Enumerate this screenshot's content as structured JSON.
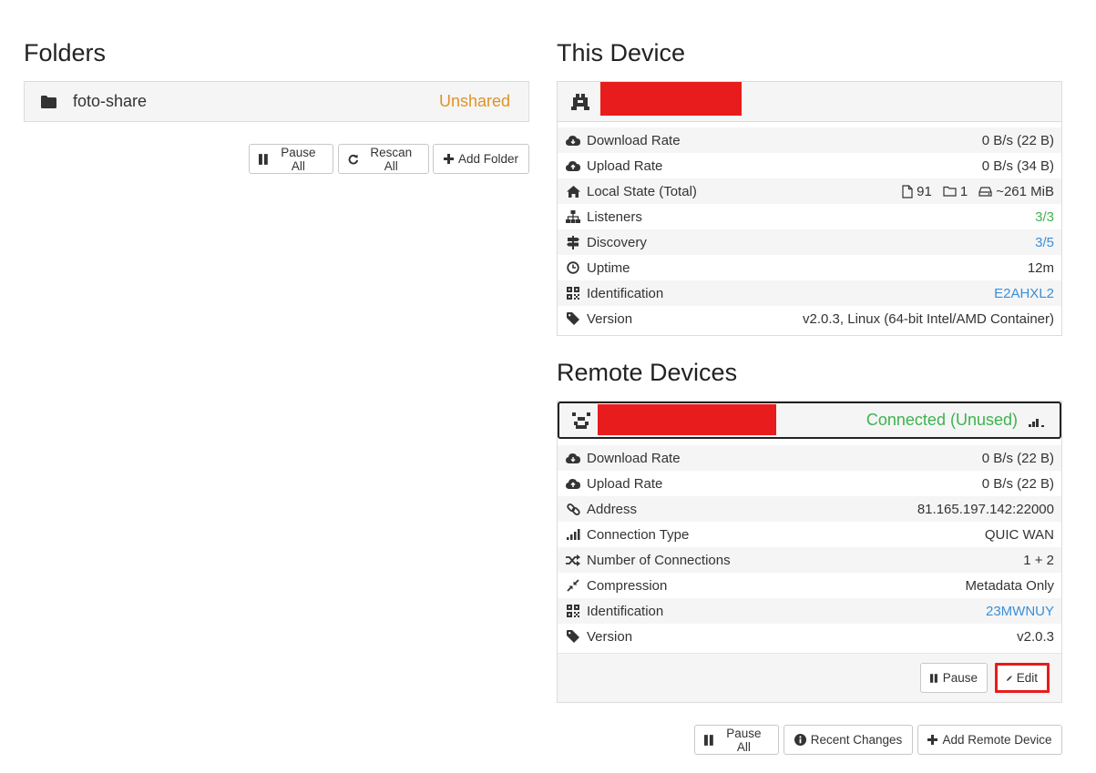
{
  "folders": {
    "heading": "Folders",
    "items": [
      {
        "name": "foto-share",
        "status": "Unshared",
        "status_color": "#e0932a"
      }
    ],
    "buttons": {
      "pause_all": "Pause All",
      "rescan_all": "Rescan All",
      "add_folder": "Add Folder"
    }
  },
  "this_device": {
    "heading": "This Device",
    "rows": [
      {
        "icon": "cloud-download-icon",
        "label": "Download Rate",
        "value": "0 B/s (22 B)"
      },
      {
        "icon": "cloud-upload-icon",
        "label": "Upload Rate",
        "value": "0 B/s (34 B)"
      },
      {
        "icon": "home-icon",
        "label": "Local State (Total)",
        "files": "91",
        "dirs": "1",
        "size": "~261 MiB"
      },
      {
        "icon": "sitemap-icon",
        "label": "Listeners",
        "value": "3/3"
      },
      {
        "icon": "signpost-icon",
        "label": "Discovery",
        "value": "3/5"
      },
      {
        "icon": "clock-icon",
        "label": "Uptime",
        "value": "12m"
      },
      {
        "icon": "qrcode-icon",
        "label": "Identification",
        "value": "E2AHXL2"
      },
      {
        "icon": "tag-icon",
        "label": "Version",
        "value": "v2.0.3, Linux (64-bit Intel/AMD Container)"
      }
    ]
  },
  "remote_devices": {
    "heading": "Remote Devices",
    "status": "Connected (Unused)",
    "rows": [
      {
        "icon": "cloud-download-icon",
        "label": "Download Rate",
        "value": "0 B/s (22 B)"
      },
      {
        "icon": "cloud-upload-icon",
        "label": "Upload Rate",
        "value": "0 B/s (22 B)"
      },
      {
        "icon": "link-icon",
        "label": "Address",
        "value": "81.165.197.142:22000"
      },
      {
        "icon": "signal-icon",
        "label": "Connection Type",
        "value": "QUIC WAN"
      },
      {
        "icon": "shuffle-icon",
        "label": "Number of Connections",
        "value": "1 + 2"
      },
      {
        "icon": "compress-icon",
        "label": "Compression",
        "value": "Metadata Only"
      },
      {
        "icon": "qrcode-icon",
        "label": "Identification",
        "value": "23MWNUY"
      },
      {
        "icon": "tag-icon",
        "label": "Version",
        "value": "v2.0.3"
      }
    ],
    "panel_buttons": {
      "pause": "Pause",
      "edit": "Edit"
    },
    "buttons": {
      "pause_all": "Pause All",
      "recent_changes": "Recent Changes",
      "add_remote_device": "Add Remote Device"
    }
  },
  "colors": {
    "link": "#3a8fd8",
    "green": "#3db350",
    "unshared": "#e0932a",
    "redaction": "#e81c1c",
    "highlight": "#e81c1c"
  }
}
